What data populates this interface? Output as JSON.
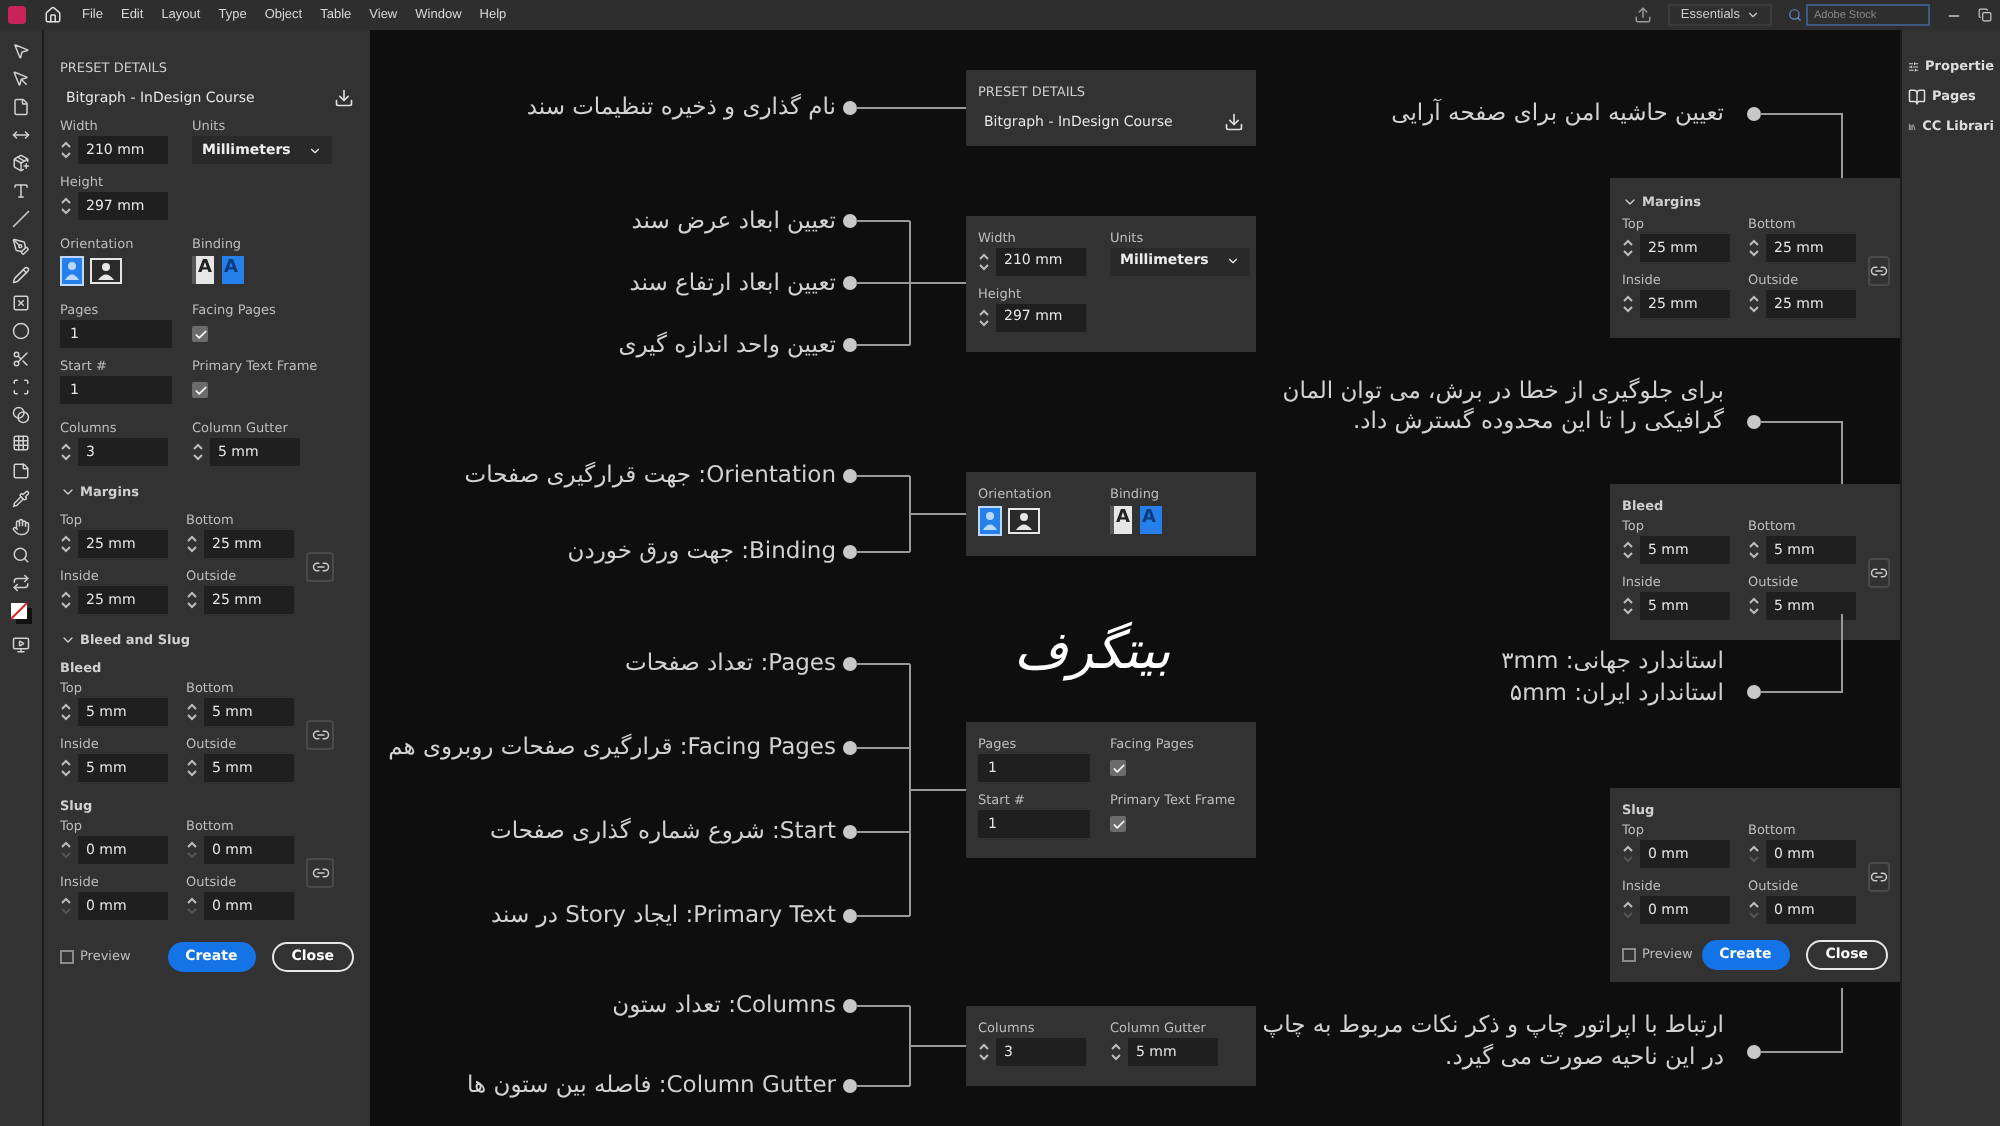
{
  "menu_bar": {
    "menus": [
      "File",
      "Edit",
      "Layout",
      "Type",
      "Object",
      "Table",
      "View",
      "Window",
      "Help"
    ],
    "workspace": "Essentials",
    "search": {
      "placeholder": "Adobe Stock"
    }
  },
  "new_document_panel": {
    "sections": [
      {
        "kind": "preset",
        "heading": "PRESET DETAILS",
        "name": "Bitgraph - InDesign Course"
      },
      {
        "kind": "grid",
        "cells": [
          {
            "kind": "spinner",
            "label": "Width",
            "value": "210 mm"
          },
          {
            "kind": "select",
            "label": "Units",
            "value": "Millimeters"
          },
          {
            "kind": "spinner",
            "label": "Height",
            "value": "297 mm"
          }
        ]
      },
      {
        "kind": "orientation",
        "orientation_label": "Orientation",
        "binding_label": "Binding",
        "orientations": [
          {
            "kind": "portrait",
            "selected": true
          },
          {
            "kind": "landscape",
            "selected": false
          }
        ],
        "bindings": [
          {
            "kind": "left",
            "glyph": "A",
            "selected": false
          },
          {
            "kind": "right",
            "glyph": "A",
            "selected": true
          }
        ]
      },
      {
        "kind": "grid",
        "cells": [
          {
            "kind": "input",
            "label": "Pages",
            "value": "1"
          },
          {
            "kind": "checkbox",
            "label": "Facing Pages",
            "checked": true
          },
          {
            "kind": "input",
            "label": "Start #",
            "value": "1"
          },
          {
            "kind": "checkbox",
            "label": "Primary Text Frame",
            "checked": true
          }
        ]
      },
      {
        "kind": "grid",
        "cells": [
          {
            "kind": "spinner",
            "label": "Columns",
            "value": "3"
          },
          {
            "kind": "spinner",
            "label": "Column Gutter",
            "value": "5 mm"
          }
        ]
      },
      {
        "kind": "heading",
        "text": "Margins",
        "expanded": true
      },
      {
        "kind": "linked",
        "cells": [
          {
            "kind": "spinner",
            "label": "Top",
            "value": "25 mm"
          },
          {
            "kind": "spinner",
            "label": "Bottom",
            "value": "25 mm"
          },
          {
            "kind": "spinner",
            "label": "Inside",
            "value": "25 mm"
          },
          {
            "kind": "spinner",
            "label": "Outside",
            "value": "25 mm"
          }
        ]
      },
      {
        "kind": "heading",
        "text": "Bleed and Slug",
        "expanded": true
      },
      {
        "kind": "linked",
        "title": "Bleed",
        "cells": [
          {
            "kind": "spinner",
            "label": "Top",
            "value": "5 mm"
          },
          {
            "kind": "spinner",
            "label": "Bottom",
            "value": "5 mm"
          },
          {
            "kind": "spinner",
            "label": "Inside",
            "value": "5 mm"
          },
          {
            "kind": "spinner",
            "label": "Outside",
            "value": "5 mm"
          }
        ]
      },
      {
        "kind": "linked",
        "title": "Slug",
        "cells": [
          {
            "kind": "spinner",
            "label": "Top",
            "value": "0 mm",
            "disabled": true
          },
          {
            "kind": "spinner",
            "label": "Bottom",
            "value": "0 mm",
            "disabled": true
          },
          {
            "kind": "spinner",
            "label": "Inside",
            "value": "0 mm",
            "disabled": true
          },
          {
            "kind": "spinner",
            "label": "Outside",
            "value": "0 mm",
            "disabled": true
          }
        ]
      },
      {
        "kind": "footer",
        "preview": {
          "label": "Preview",
          "checked": false
        },
        "buttons": [
          {
            "label": "Create",
            "primary": true
          },
          {
            "label": "Close",
            "primary": false
          }
        ]
      }
    ]
  },
  "canvas": {
    "logo": "بیتگرف",
    "left_callouts": [
      {
        "labels": [
          "نام گذاری و ذخیره تنظیمات سند"
        ],
        "panel": {
          "sections": [
            {
              "kind": "preset",
              "heading": "PRESET DETAILS",
              "name": "Bitgraph - InDesign Course"
            }
          ]
        }
      },
      {
        "labels": [
          "تعیین ابعاد عرض سند",
          "تعیین ابعاد ارتفاع سند",
          "تعیین واحد اندازه گیری"
        ],
        "panel": {
          "sections": [
            {
              "kind": "grid",
              "cells": [
                {
                  "kind": "spinner",
                  "label": "Width",
                  "value": "210 mm"
                },
                {
                  "kind": "select",
                  "label": "Units",
                  "value": "Millimeters"
                },
                {
                  "kind": "spinner",
                  "label": "Height",
                  "value": "297 mm"
                }
              ]
            }
          ]
        }
      },
      {
        "labels": [
          "Orientation: جهت قرارگیری صفحات",
          "Binding: جهت ورق خوردن"
        ],
        "panel": {
          "sections": [
            {
              "kind": "orientation",
              "orientation_label": "Orientation",
              "binding_label": "Binding",
              "orientations": [
                {
                  "kind": "portrait",
                  "selected": true
                },
                {
                  "kind": "landscape",
                  "selected": false
                }
              ],
              "bindings": [
                {
                  "kind": "left",
                  "glyph": "A",
                  "selected": false
                },
                {
                  "kind": "right",
                  "glyph": "A",
                  "selected": true
                }
              ]
            }
          ]
        }
      },
      {
        "labels": [
          "Pages: تعداد صفحات",
          "Facing Pages: قرارگیری صفحات روبروی هم",
          "Start: شروع شماره گذاری صفحات",
          "Primary Text: ایجاد Story در سند"
        ],
        "panel": {
          "sections": [
            {
              "kind": "grid",
              "cells": [
                {
                  "kind": "input",
                  "label": "Pages",
                  "value": "1"
                },
                {
                  "kind": "checkbox",
                  "label": "Facing Pages",
                  "checked": true
                },
                {
                  "kind": "input",
                  "label": "Start #",
                  "value": "1"
                },
                {
                  "kind": "checkbox",
                  "label": "Primary Text Frame",
                  "checked": true
                }
              ]
            }
          ]
        }
      },
      {
        "labels": [
          "Columns: تعداد ستون",
          "Column Gutter: فاصله بین ستون ها"
        ],
        "panel": {
          "sections": [
            {
              "kind": "grid",
              "cells": [
                {
                  "kind": "spinner",
                  "label": "Columns",
                  "value": "3"
                },
                {
                  "kind": "spinner",
                  "label": "Column Gutter",
                  "value": "5 mm"
                }
              ]
            }
          ]
        }
      }
    ],
    "right_callouts": [
      {
        "above": [
          "تعیین حاشیه امن برای صفحه آرایی"
        ],
        "panel": {
          "sections": [
            {
              "kind": "heading",
              "text": "Margins",
              "expanded": true
            },
            {
              "kind": "linked",
              "cells": [
                {
                  "kind": "spinner",
                  "label": "Top",
                  "value": "25 mm"
                },
                {
                  "kind": "spinner",
                  "label": "Bottom",
                  "value": "25 mm"
                },
                {
                  "kind": "spinner",
                  "label": "Inside",
                  "value": "25 mm"
                },
                {
                  "kind": "spinner",
                  "label": "Outside",
                  "value": "25 mm"
                }
              ]
            }
          ]
        }
      },
      {
        "above": [
          "برای جلوگیری از خطا در برش، می توان المان گرافیکی را تا این محدوده گسترش داد."
        ],
        "panel": {
          "sections": [
            {
              "kind": "linked",
              "title": "Bleed",
              "cells": [
                {
                  "kind": "spinner",
                  "label": "Top",
                  "value": "5 mm"
                },
                {
                  "kind": "spinner",
                  "label": "Bottom",
                  "value": "5 mm"
                },
                {
                  "kind": "spinner",
                  "label": "Inside",
                  "value": "5 mm"
                },
                {
                  "kind": "spinner",
                  "label": "Outside",
                  "value": "5 mm"
                }
              ]
            }
          ]
        },
        "below": [
          "استاندارد جهانی: ۳mm",
          "استاندارد ایران: ۵mm"
        ]
      },
      {
        "panel": {
          "sections": [
            {
              "kind": "linked",
              "title": "Slug",
              "cells": [
                {
                  "kind": "spinner",
                  "label": "Top",
                  "value": "0 mm",
                  "disabled": true
                },
                {
                  "kind": "spinner",
                  "label": "Bottom",
                  "value": "0 mm",
                  "disabled": true
                },
                {
                  "kind": "spinner",
                  "label": "Inside",
                  "value": "0 mm",
                  "disabled": true
                },
                {
                  "kind": "spinner",
                  "label": "Outside",
                  "value": "0 mm",
                  "disabled": true
                }
              ]
            },
            {
              "kind": "footer",
              "preview": {
                "label": "Preview",
                "checked": false
              },
              "buttons": [
                {
                  "label": "Create",
                  "primary": true
                },
                {
                  "label": "Close",
                  "primary": false
                }
              ]
            }
          ]
        },
        "below": [
          "ارتباط با اپراتور چاپ و ذکر نکات مربوط به چاپ در این ناحیه صورت می گیرد."
        ]
      }
    ]
  },
  "side_panel": {
    "items": [
      {
        "kind": "properties",
        "label": "Propertie"
      },
      {
        "kind": "pages",
        "label": "Pages"
      },
      {
        "kind": "libraries",
        "label": "CC Librari"
      }
    ]
  }
}
